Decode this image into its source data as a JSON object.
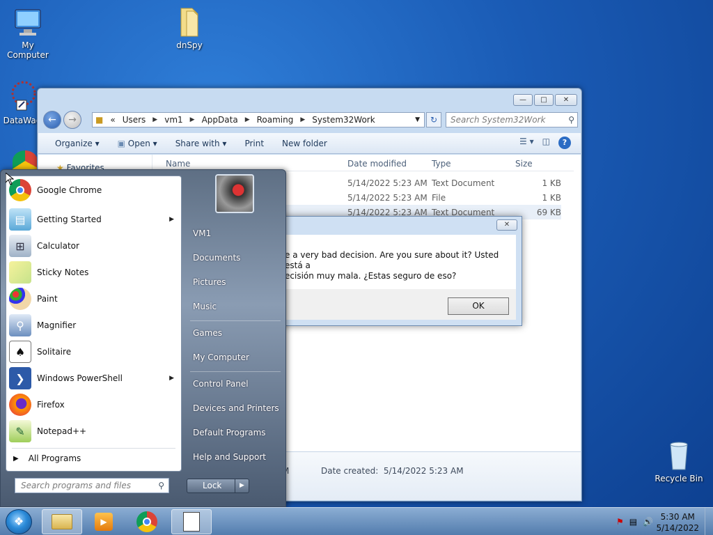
{
  "desktop": {
    "icons": [
      {
        "label": "My Computer"
      },
      {
        "label": "dnSpy"
      },
      {
        "label": "DataWag"
      },
      {
        "label": "Recycle Bin"
      }
    ]
  },
  "explorer": {
    "address": {
      "overflow": "«",
      "path": [
        "Users",
        "vm1",
        "AppData",
        "Roaming",
        "System32Work"
      ]
    },
    "search_placeholder": "Search System32Work",
    "toolbar": {
      "organize": "Organize",
      "open": "Open",
      "share_with": "Share with",
      "print": "Print",
      "new_folder": "New folder"
    },
    "nav_pane": {
      "favorites": "Favorites"
    },
    "columns": {
      "name": "Name",
      "date": "Date modified",
      "type": "Type",
      "size": "Size"
    },
    "files": [
      {
        "date": "5/14/2022 5:23 AM",
        "type": "Text Document",
        "size": "1 KB"
      },
      {
        "date": "5/14/2022 5:23 AM",
        "type": "File",
        "size": "1 KB"
      },
      {
        "date": "5/14/2022 5:23 AM",
        "type": "Text Document",
        "size": "69 KB"
      }
    ],
    "details": {
      "date_modified_partial": "M",
      "date_created_label": "Date created:",
      "date_created_value": "5/14/2022 5:23 AM"
    }
  },
  "dialog": {
    "message_line1": "e a very bad decision. Are you sure about it? Usted está a",
    "message_line2": "ecisión muy mala. ¿Estas seguro de eso?",
    "ok": "OK"
  },
  "start_menu": {
    "programs": [
      {
        "label": "Google Chrome",
        "icon": "chrome-icon"
      },
      {
        "label": "Getting Started",
        "icon": "getting-started-icon",
        "submenu": true
      },
      {
        "label": "Calculator",
        "icon": "calculator-icon"
      },
      {
        "label": "Sticky Notes",
        "icon": "sticky-notes-icon"
      },
      {
        "label": "Paint",
        "icon": "paint-icon"
      },
      {
        "label": "Magnifier",
        "icon": "magnifier-icon"
      },
      {
        "label": "Solitaire",
        "icon": "solitaire-icon"
      },
      {
        "label": "Windows PowerShell",
        "icon": "powershell-icon",
        "submenu": true
      },
      {
        "label": "Firefox",
        "icon": "firefox-icon"
      },
      {
        "label": "Notepad++",
        "icon": "notepadpp-icon"
      }
    ],
    "all_programs": "All Programs",
    "search_placeholder": "Search programs and files",
    "right": {
      "user": "VM1",
      "documents": "Documents",
      "pictures": "Pictures",
      "music": "Music",
      "games": "Games",
      "my_computer": "My Computer",
      "control_panel": "Control Panel",
      "devices_printers": "Devices and Printers",
      "default_programs": "Default Programs",
      "help_support": "Help and Support"
    },
    "lock": "Lock"
  },
  "taskbar": {
    "clock_time": "5:30 AM",
    "clock_date": "5/14/2022"
  }
}
